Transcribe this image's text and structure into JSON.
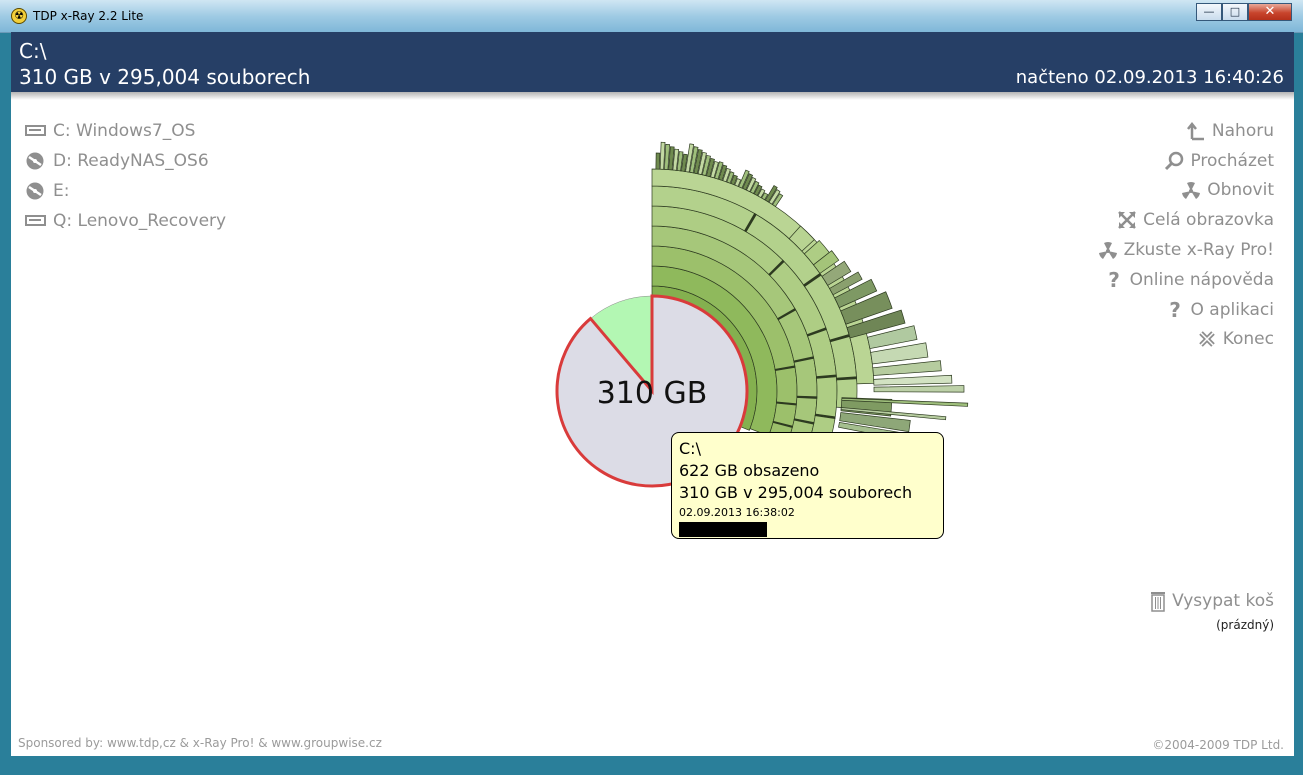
{
  "window": {
    "title": "TDP x-Ray 2.2 Lite",
    "minimize_glyph": "—",
    "maximize_glyph": "□",
    "close_glyph": "✕"
  },
  "header": {
    "path": "C:\\",
    "summary": "310 GB v 295,004 souborech",
    "loaded": "načteno 02.09.2013 16:40:26"
  },
  "drives": [
    {
      "letter": "C:",
      "name": "Windows7_OS",
      "icon": "hard-drive-icon"
    },
    {
      "letter": "D:",
      "name": "ReadyNAS_OS6",
      "icon": "network-drive-icon"
    },
    {
      "letter": "E:",
      "name": "",
      "icon": "network-drive-icon"
    },
    {
      "letter": "Q:",
      "name": "Lenovo_Recovery",
      "icon": "hard-drive-icon"
    }
  ],
  "menu": [
    {
      "label": "Nahoru",
      "icon": "arrow-up-icon"
    },
    {
      "label": "Procházet",
      "icon": "magnifier-icon"
    },
    {
      "label": "Obnovit",
      "icon": "radiation-icon"
    },
    {
      "label": "Celá obrazovka",
      "icon": "fullscreen-icon"
    },
    {
      "label": "Zkuste x-Ray Pro!",
      "icon": "radiation-icon"
    },
    {
      "label": "Online nápověda",
      "icon": "question-icon"
    },
    {
      "label": "O aplikaci",
      "icon": "question-icon"
    },
    {
      "label": "Konec",
      "icon": "close-x-icon"
    }
  ],
  "trash": {
    "label": "Vysypat koš",
    "status": "(prázdný)",
    "icon": "trash-icon"
  },
  "viz": {
    "center_label": "310 GB",
    "used_fraction": 0.888,
    "colors": {
      "used": "#dcdce6",
      "free": "#b3f7b3",
      "outline": "#d93b3b"
    }
  },
  "tooltip": {
    "path": "C:\\",
    "contains": "622 GB obsazeno",
    "summary": "310 GB v 295,004 souborech",
    "date": "02.09.2013 16:38:02"
  },
  "footer": {
    "sponsored": "Sponsored by: www.tdp,cz & x-Ray Pro! & www.groupwise.cz",
    "copyright": "©2004-2009 TDP Ltd."
  }
}
